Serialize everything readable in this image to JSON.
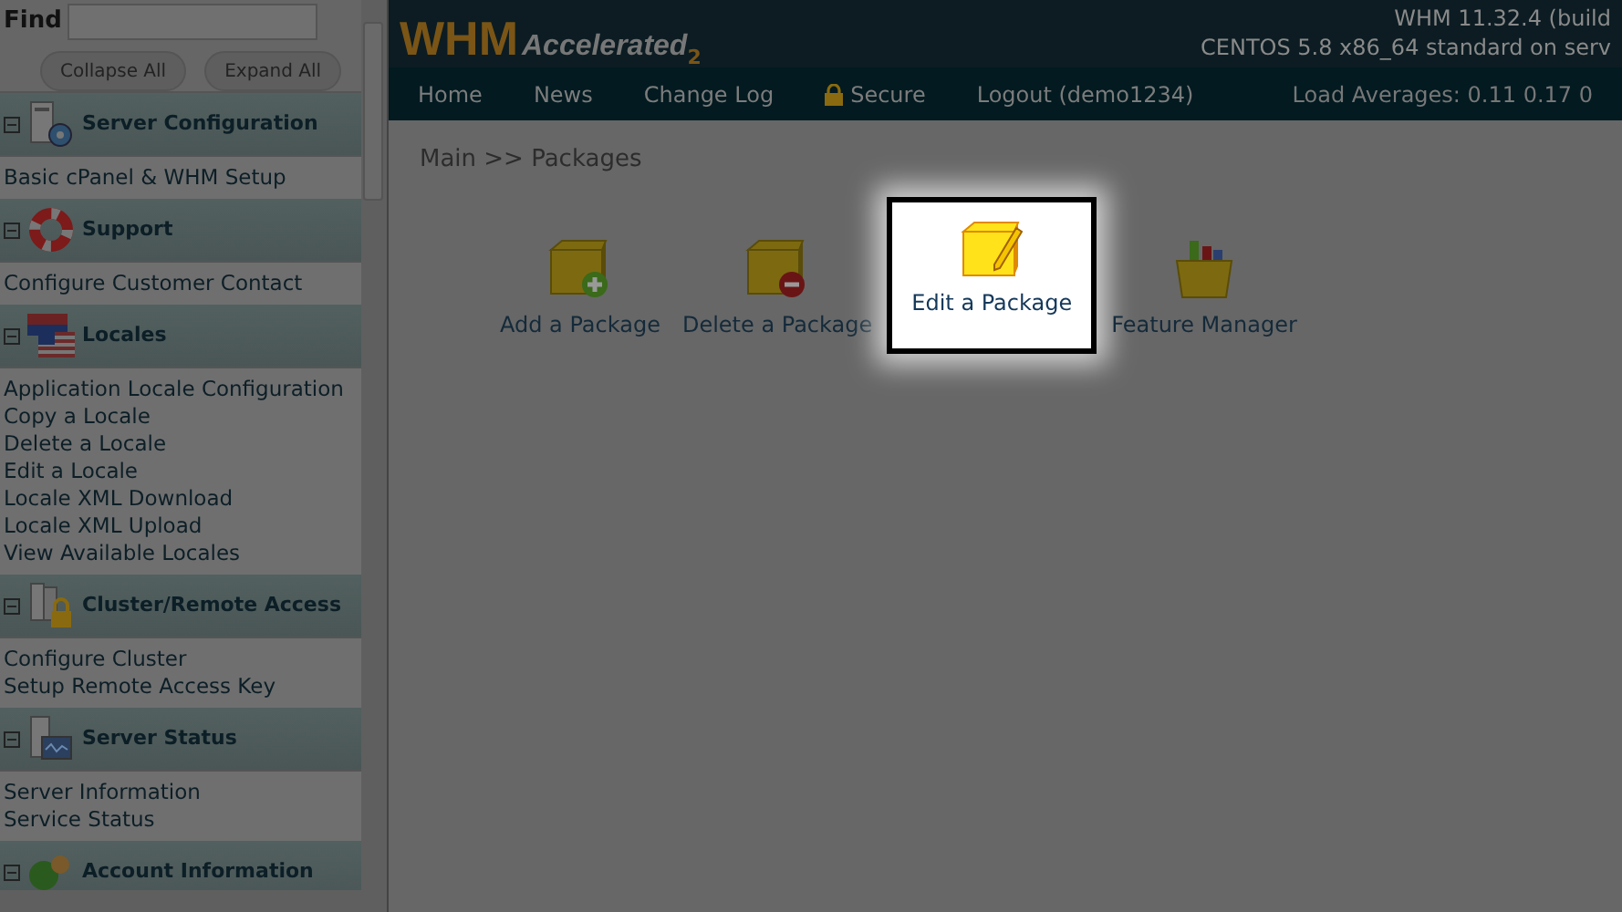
{
  "sidebar": {
    "find_label": "Find",
    "buttons": [
      "Collapse All",
      "Expand All"
    ],
    "sections": [
      {
        "title": "Server Configuration",
        "kind": "server",
        "items": [
          "Basic cPanel & WHM Setup"
        ]
      },
      {
        "title": "Support",
        "kind": "support",
        "items": [
          "Configure Customer Contact"
        ]
      },
      {
        "title": "Locales",
        "kind": "flag",
        "items": [
          "Application Locale Configuration",
          "Copy a Locale",
          "Delete a Locale",
          "Edit a Locale",
          "Locale XML Download",
          "Locale XML Upload",
          "View Available Locales"
        ]
      },
      {
        "title": "Cluster/Remote Access",
        "kind": "lock",
        "items": [
          "Configure Cluster",
          "Setup Remote Access Key"
        ]
      },
      {
        "title": "Server Status",
        "kind": "status",
        "items": [
          "Server Information",
          "Service Status"
        ]
      },
      {
        "title": "Account Information",
        "kind": "account"
      }
    ]
  },
  "header": {
    "logo": "WHM",
    "logo_sub": "Accelerated",
    "logo_sup": "2",
    "version": "WHM 11.32.4 (build",
    "os": "CENTOS 5.8 x86_64 standard on serv"
  },
  "nav": [
    {
      "label": "Home",
      "kind": "link"
    },
    {
      "label": "News",
      "kind": "link"
    },
    {
      "label": "Change Log",
      "kind": "link"
    },
    {
      "label": "Secure",
      "kind": "lock"
    },
    {
      "label": "Logout (demo1234)",
      "kind": "link"
    }
  ],
  "load": "Load Averages: 0.11 0.17 0",
  "breadcrumb": "Main >> Packages",
  "packages": [
    {
      "label": "Add a Package",
      "kind": "add",
      "highlighted": false
    },
    {
      "label": "Delete a Package",
      "kind": "delete",
      "highlighted": false
    },
    {
      "label": "Edit a Package",
      "kind": "edit",
      "highlighted": true
    },
    {
      "label": "Feature Manager",
      "kind": "feature",
      "highlighted": false
    }
  ]
}
